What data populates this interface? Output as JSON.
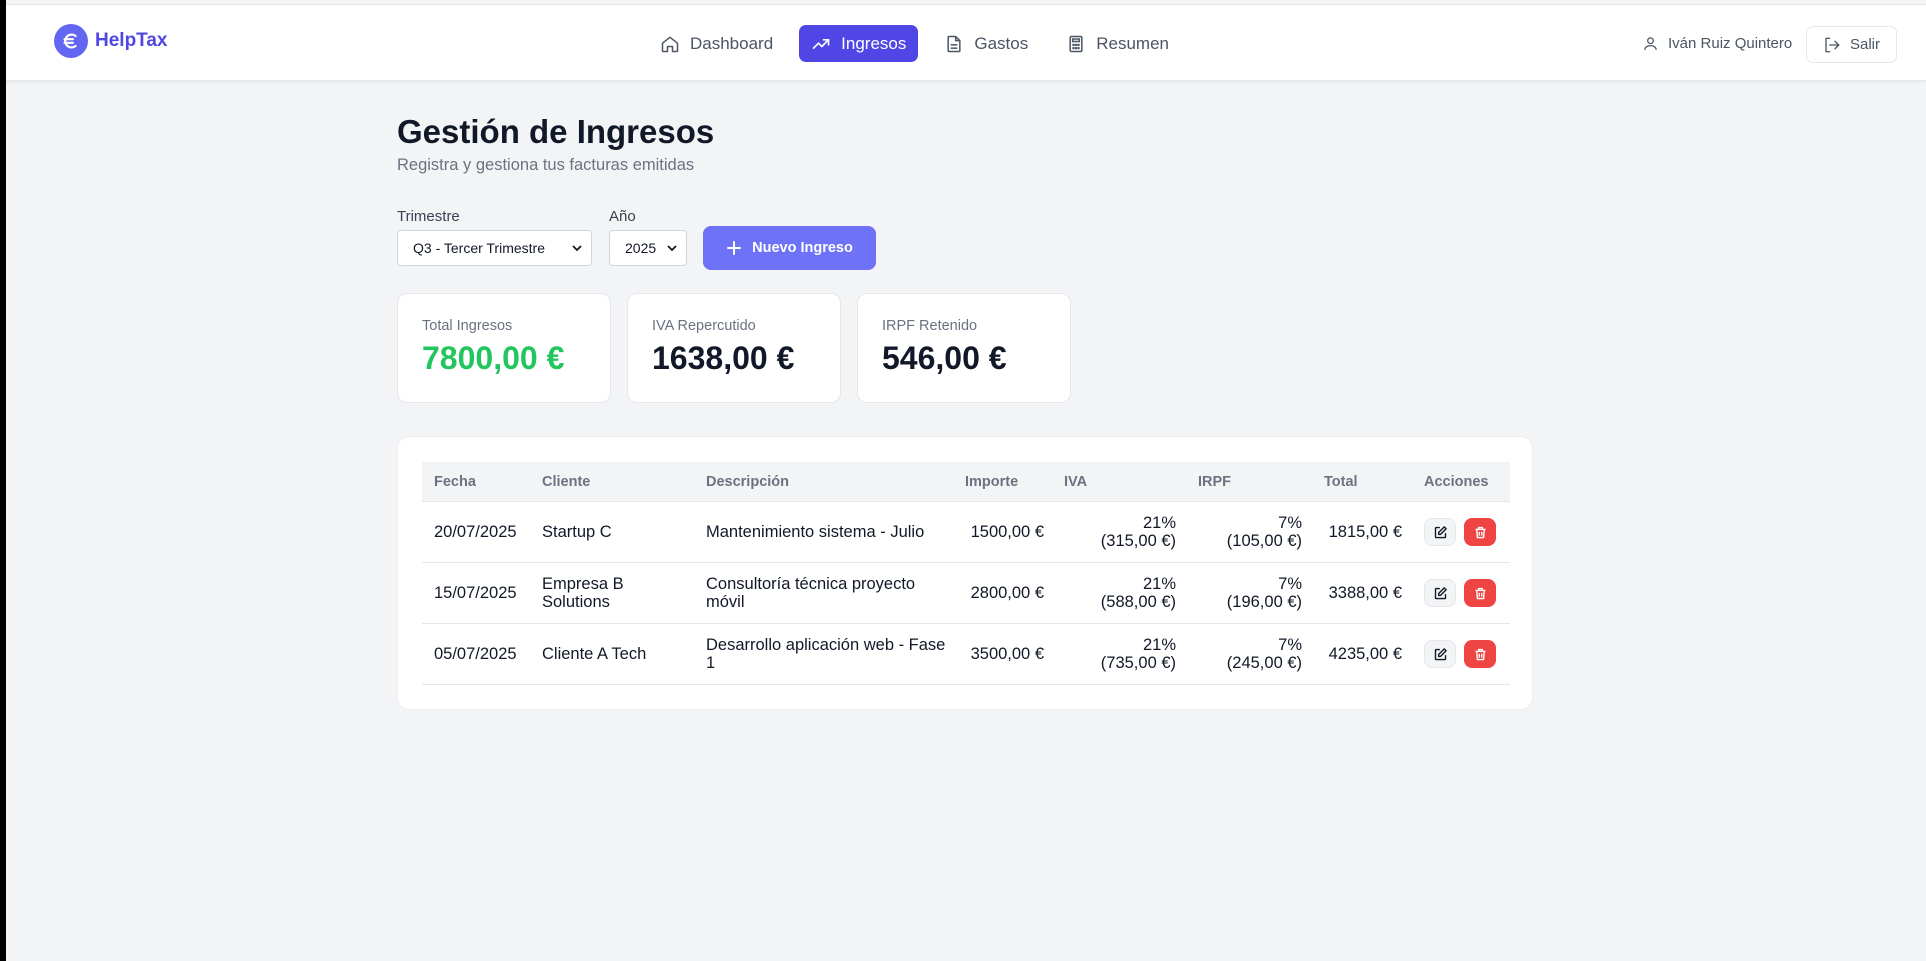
{
  "brand": {
    "name": "HelpTax",
    "logo_icon": "euro-icon",
    "color": "#4f46e5"
  },
  "nav": {
    "items": [
      {
        "label": "Dashboard",
        "icon": "home-icon",
        "active": false
      },
      {
        "label": "Ingresos",
        "icon": "trending-up-icon",
        "active": true
      },
      {
        "label": "Gastos",
        "icon": "file-text-icon",
        "active": false
      },
      {
        "label": "Resumen",
        "icon": "calculator-icon",
        "active": false
      }
    ],
    "active_color": "#4f46e5"
  },
  "user": {
    "name": "Iván Ruiz Quintero",
    "icon": "user-icon"
  },
  "logout": {
    "label": "Salir",
    "icon": "log-out-icon"
  },
  "page": {
    "title": "Gestión de Ingresos",
    "subtitle": "Registra y gestiona tus facturas emitidas"
  },
  "filters": {
    "quarter_label": "Trimestre",
    "quarter_value": "Q3 - Tercer Trimestre",
    "year_label": "Año",
    "year_value": "2025",
    "new_button": "Nuevo Ingreso"
  },
  "cards": [
    {
      "label": "Total Ingresos",
      "value": "7800,00 €",
      "color": "#22c55e"
    },
    {
      "label": "IVA Repercutido",
      "value": "1638,00 €",
      "color": "#111827"
    },
    {
      "label": "IRPF Retenido",
      "value": "546,00 €",
      "color": "#111827"
    }
  ],
  "table": {
    "headers": [
      "Fecha",
      "Cliente",
      "Descripción",
      "Importe",
      "IVA",
      "IRPF",
      "Total",
      "Acciones"
    ],
    "rows": [
      {
        "fecha": "20/07/2025",
        "cliente": "Startup C",
        "descripcion": "Mantenimiento sistema - Julio",
        "importe": "1500,00 €",
        "iva_pct": "21%",
        "iva_amt": "(315,00 €)",
        "irpf_pct": "7%",
        "irpf_amt": "(105,00 €)",
        "total": "1815,00 €"
      },
      {
        "fecha": "15/07/2025",
        "cliente": "Empresa B Solutions",
        "descripcion": "Consultoría técnica proyecto móvil",
        "importe": "2800,00 €",
        "iva_pct": "21%",
        "iva_amt": "(588,00 €)",
        "irpf_pct": "7%",
        "irpf_amt": "(196,00 €)",
        "total": "3388,00 €"
      },
      {
        "fecha": "05/07/2025",
        "cliente": "Cliente A Tech",
        "descripcion": "Desarrollo aplicación web - Fase 1",
        "importe": "3500,00 €",
        "iva_pct": "21%",
        "iva_amt": "(735,00 €)",
        "irpf_pct": "7%",
        "irpf_amt": "(245,00 €)",
        "total": "4235,00 €"
      }
    ],
    "edit_icon": "edit-icon",
    "delete_icon": "trash-icon",
    "delete_color": "#ef4444"
  }
}
